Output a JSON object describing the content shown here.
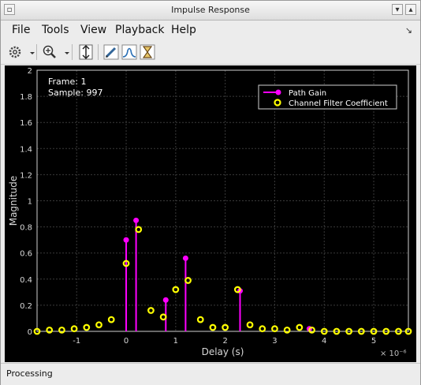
{
  "window": {
    "title": "Impulse Response"
  },
  "menu": {
    "items": [
      "File",
      "Tools",
      "View",
      "Playback",
      "Help"
    ]
  },
  "toolbar": {
    "icons": [
      "gear-icon",
      "zoom-in-icon",
      "fit-vertical-icon",
      "edit-pen-icon",
      "distribution-icon",
      "hourglass-icon"
    ]
  },
  "overlay": {
    "frame": "Frame: 1",
    "sample": "Sample: 997"
  },
  "status": {
    "text": "Processing"
  },
  "colors": {
    "path_gain": "#ff00ff",
    "filter_coeff": "#ffff00",
    "background": "#000000",
    "grid": "#3a3a3a"
  },
  "chart_data": {
    "type": "scatter",
    "xlabel": "Delay (s)",
    "ylabel": "Magnitude",
    "x_exponent": "× 10⁻⁶",
    "xlim": [
      -1.8,
      5.7
    ],
    "ylim": [
      0,
      2
    ],
    "xticks": [
      -1,
      0,
      1,
      2,
      3,
      4,
      5
    ],
    "yticks": [
      0,
      0.2,
      0.4,
      0.6,
      0.8,
      1,
      1.2,
      1.4,
      1.6,
      1.8,
      2
    ],
    "grid": true,
    "legend_position": "top-right",
    "series": [
      {
        "name": "Path Gain",
        "style": "stem",
        "x": [
          0.0,
          0.2,
          0.8,
          1.2,
          2.3,
          3.7
        ],
        "y": [
          0.7,
          0.85,
          0.24,
          0.56,
          0.31,
          0.02
        ]
      },
      {
        "name": "Channel Filter Coefficient",
        "style": "circle",
        "x": [
          -1.8,
          -1.55,
          -1.3,
          -1.05,
          -0.8,
          -0.55,
          -0.3,
          0.0,
          0.25,
          0.5,
          0.75,
          1.0,
          1.25,
          1.5,
          1.75,
          2.0,
          2.25,
          2.5,
          2.75,
          3.0,
          3.25,
          3.5,
          3.75,
          4.0,
          4.25,
          4.5,
          4.75,
          5.0,
          5.25,
          5.5,
          5.7
        ],
        "y": [
          0.0,
          0.01,
          0.01,
          0.02,
          0.03,
          0.05,
          0.09,
          0.52,
          0.78,
          0.16,
          0.11,
          0.32,
          0.39,
          0.09,
          0.03,
          0.03,
          0.32,
          0.05,
          0.02,
          0.02,
          0.01,
          0.03,
          0.01,
          0.0,
          0.0,
          0.0,
          0.0,
          0.0,
          0.0,
          0.0,
          0.0
        ]
      }
    ]
  }
}
